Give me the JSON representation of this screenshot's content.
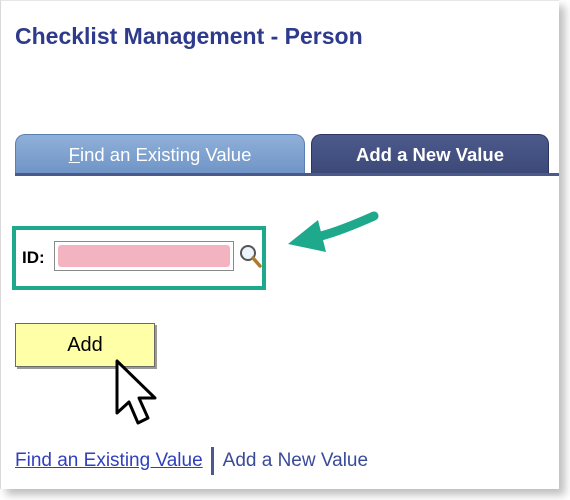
{
  "page": {
    "title": "Checklist Management - Person"
  },
  "tabs": {
    "find_accesskey": "F",
    "find_rest": "ind an Existing Value",
    "add_label": "Add a New Value",
    "active": "add"
  },
  "search": {
    "id_label": "ID:",
    "id_value": "",
    "lookup_icon": "magnifier-icon"
  },
  "actions": {
    "add_label": "Add"
  },
  "footer_links": {
    "find_label": "Find an Existing Value",
    "add_label": "Add a New Value"
  },
  "colors": {
    "title": "#2e3a8c",
    "active_tab": "#434f82",
    "inactive_tab": "#7b9ccb",
    "highlight_box": "#1ea88c",
    "add_button": "#ffffa8",
    "redaction": "#f4b3c1"
  }
}
